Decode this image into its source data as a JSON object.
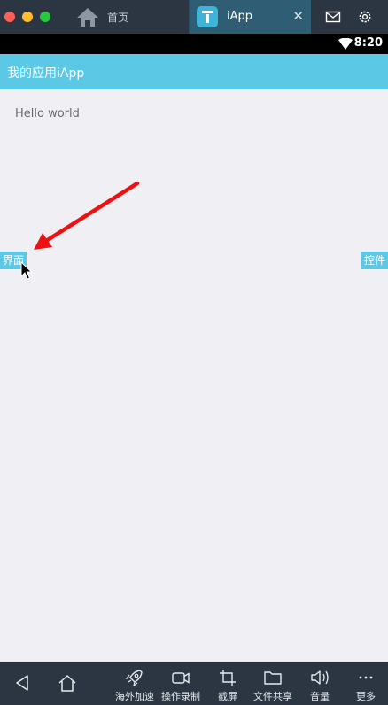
{
  "window": {
    "tabs": [
      {
        "label": "首页",
        "icon": "home-icon",
        "active": false
      },
      {
        "label": "iApp",
        "icon": "iapp-icon",
        "active": true
      }
    ],
    "close_glyph": "✕",
    "toolbar_icons": [
      "mail-icon",
      "settings-gear-icon"
    ]
  },
  "status_bar": {
    "time": "8:20",
    "icons": [
      "wifi-icon"
    ]
  },
  "app": {
    "title": "我的应用iApp",
    "content_text": "Hello world",
    "left_tab": "界面",
    "right_tab": "控件",
    "colors": {
      "accent": "#5bc8e6",
      "background": "#f0eff4",
      "annotation_arrow": "#ee1111"
    }
  },
  "bottom_bar": {
    "nav": [
      "back-icon",
      "home-icon"
    ],
    "items": [
      {
        "label": "海外加速",
        "icon": "rocket-icon"
      },
      {
        "label": "操作录制",
        "icon": "video-record-icon"
      },
      {
        "label": "截屏",
        "icon": "crop-icon"
      },
      {
        "label": "文件共享",
        "icon": "folder-icon"
      },
      {
        "label": "音量",
        "icon": "volume-icon"
      },
      {
        "label": "更多",
        "icon": "more-icon"
      }
    ]
  }
}
